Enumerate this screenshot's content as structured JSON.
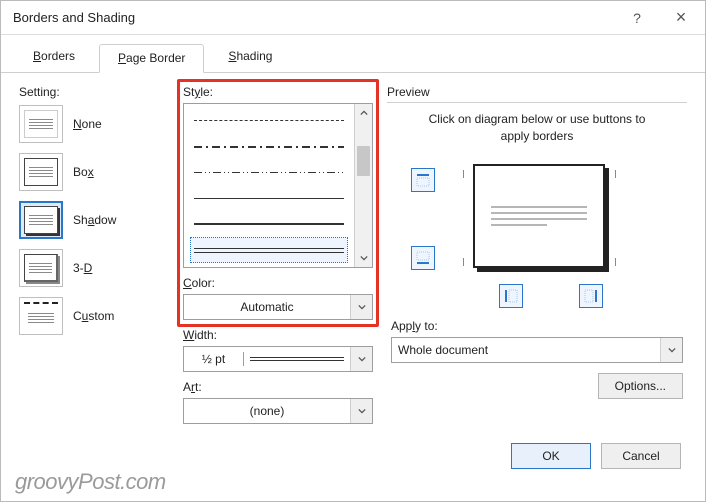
{
  "window": {
    "title": "Borders and Shading",
    "help_tooltip": "?",
    "close_tooltip": "×"
  },
  "tabs": {
    "borders": "Borders",
    "page_border": "Page Border",
    "shading": "Shading"
  },
  "setting": {
    "label": "Setting:",
    "none": "None",
    "box": "Box",
    "shadow": "Shadow",
    "threeD": "3-D",
    "custom": "Custom"
  },
  "style": {
    "label": "Style:"
  },
  "color": {
    "label": "Color:",
    "value": "Automatic"
  },
  "width": {
    "label": "Width:",
    "value": "½ pt"
  },
  "art": {
    "label": "Art:",
    "value": "(none)"
  },
  "preview": {
    "label": "Preview",
    "hint": "Click on diagram below or use buttons to apply borders"
  },
  "apply_to": {
    "label": "Apply to:",
    "value": "Whole document"
  },
  "buttons": {
    "options": "Options...",
    "ok": "OK",
    "cancel": "Cancel"
  },
  "watermark": "groovyPost.com"
}
